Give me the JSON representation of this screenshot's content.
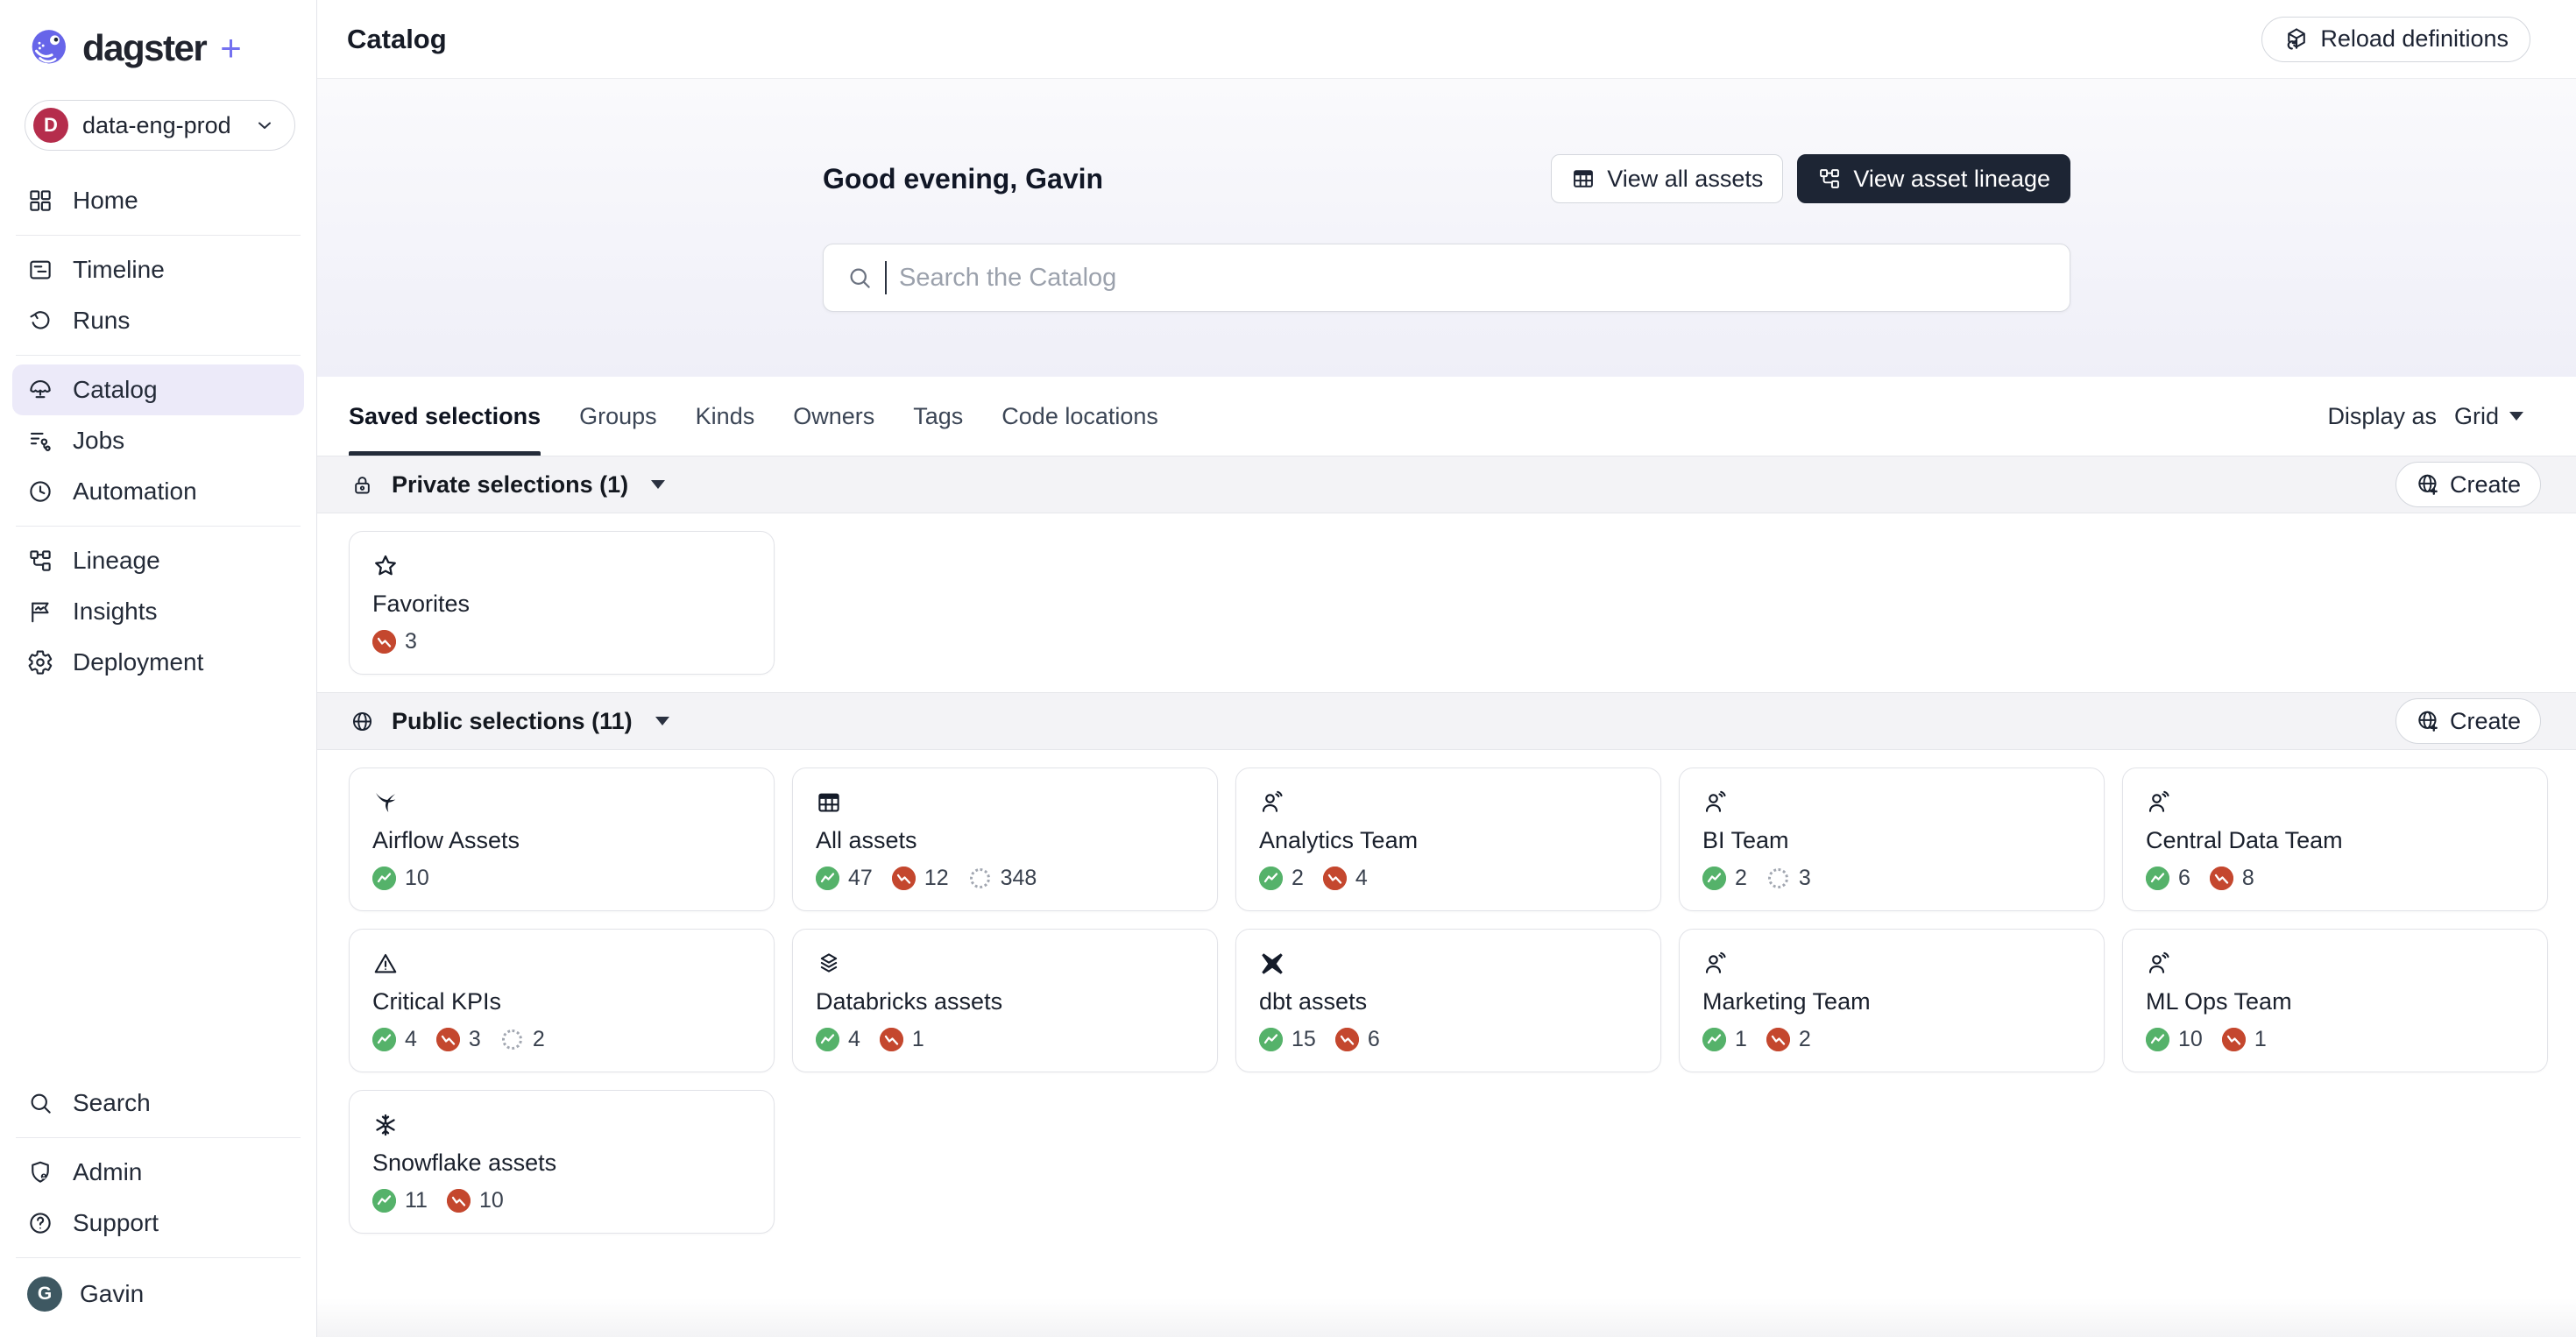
{
  "brand": {
    "name": "dagster",
    "plus": "+"
  },
  "deployment": {
    "avatar_letter": "D",
    "label": "data-eng-prod",
    "caret_icon": "chevron-down-icon"
  },
  "sidebar": {
    "nav_groups": [
      {
        "items": [
          {
            "label": "Home",
            "icon": "grid-icon",
            "active": false
          }
        ]
      },
      {
        "items": [
          {
            "label": "Timeline",
            "icon": "timeline-icon",
            "active": false
          },
          {
            "label": "Runs",
            "icon": "runs-icon",
            "active": false
          }
        ]
      },
      {
        "items": [
          {
            "label": "Catalog",
            "icon": "catalog-icon",
            "active": true
          },
          {
            "label": "Jobs",
            "icon": "jobs-icon",
            "active": false
          },
          {
            "label": "Automation",
            "icon": "clock-icon",
            "active": false
          }
        ]
      },
      {
        "items": [
          {
            "label": "Lineage",
            "icon": "lineage-icon",
            "active": false
          },
          {
            "label": "Insights",
            "icon": "insights-icon",
            "active": false
          },
          {
            "label": "Deployment",
            "icon": "gear-icon",
            "active": false
          }
        ]
      }
    ],
    "footer_groups": [
      {
        "items": [
          {
            "label": "Search",
            "icon": "search-icon",
            "active": false
          }
        ]
      },
      {
        "items": [
          {
            "label": "Admin",
            "icon": "shield-icon",
            "active": false
          },
          {
            "label": "Support",
            "icon": "help-icon",
            "active": false
          }
        ]
      }
    ],
    "user": {
      "avatar_letter": "G",
      "name": "Gavin"
    }
  },
  "header": {
    "title": "Catalog",
    "reload_label": "Reload definitions",
    "reload_icon": "cube-reload-icon"
  },
  "hero": {
    "greeting": "Good evening, Gavin",
    "view_all_assets_label": "View all assets",
    "view_all_assets_icon": "table-icon",
    "view_asset_lineage_label": "View asset lineage",
    "view_asset_lineage_icon": "lineage-icon",
    "search_placeholder": "Search the Catalog"
  },
  "tabs": {
    "items": [
      "Saved selections",
      "Groups",
      "Kinds",
      "Owners",
      "Tags",
      "Code locations"
    ],
    "active": "Saved selections",
    "display_as_label": "Display as",
    "display_as_value": "Grid"
  },
  "sections": [
    {
      "id": "private",
      "icon": "lock-icon",
      "title": "Private selections (1)",
      "create_label": "Create",
      "create_icon": "globe-plus-icon",
      "cards": [
        {
          "title": "Favorites",
          "icon": "star-icon",
          "stats": [
            {
              "type": "failed",
              "value": "3"
            }
          ]
        }
      ]
    },
    {
      "id": "public",
      "icon": "globe-icon",
      "title": "Public selections (11)",
      "create_label": "Create",
      "create_icon": "globe-plus-icon",
      "cards": [
        {
          "title": "Airflow Assets",
          "icon": "airflow-icon",
          "stats": [
            {
              "type": "success",
              "value": "10"
            }
          ]
        },
        {
          "title": "All assets",
          "icon": "table-icon",
          "stats": [
            {
              "type": "success",
              "value": "47"
            },
            {
              "type": "failed",
              "value": "12"
            },
            {
              "type": "pending",
              "value": "348"
            }
          ]
        },
        {
          "title": "Analytics Team",
          "icon": "users-icon",
          "stats": [
            {
              "type": "success",
              "value": "2"
            },
            {
              "type": "failed",
              "value": "4"
            }
          ]
        },
        {
          "title": "BI Team",
          "icon": "users-icon",
          "stats": [
            {
              "type": "success",
              "value": "2"
            },
            {
              "type": "pending",
              "value": "3"
            }
          ]
        },
        {
          "title": "Central Data Team",
          "icon": "users-icon",
          "stats": [
            {
              "type": "success",
              "value": "6"
            },
            {
              "type": "failed",
              "value": "8"
            }
          ]
        },
        {
          "title": "Critical KPIs",
          "icon": "warning-icon",
          "stats": [
            {
              "type": "success",
              "value": "4"
            },
            {
              "type": "failed",
              "value": "3"
            },
            {
              "type": "pending",
              "value": "2"
            }
          ]
        },
        {
          "title": "Databricks assets",
          "icon": "layers-icon",
          "stats": [
            {
              "type": "success",
              "value": "4"
            },
            {
              "type": "failed",
              "value": "1"
            }
          ]
        },
        {
          "title": "dbt assets",
          "icon": "dbt-icon",
          "stats": [
            {
              "type": "success",
              "value": "15"
            },
            {
              "type": "failed",
              "value": "6"
            }
          ]
        },
        {
          "title": "Marketing Team",
          "icon": "users-icon",
          "stats": [
            {
              "type": "success",
              "value": "1"
            },
            {
              "type": "failed",
              "value": "2"
            }
          ]
        },
        {
          "title": "ML Ops Team",
          "icon": "users-icon",
          "stats": [
            {
              "type": "success",
              "value": "10"
            },
            {
              "type": "failed",
              "value": "1"
            }
          ]
        },
        {
          "title": "Snowflake assets",
          "icon": "snowflake-icon",
          "stats": [
            {
              "type": "success",
              "value": "11"
            },
            {
              "type": "failed",
              "value": "10"
            }
          ]
        }
      ]
    }
  ],
  "colors": {
    "accent": "#6765E9",
    "nav_active_bg": "#ECEAF9",
    "success": "#55B26A",
    "failed": "#C4472E",
    "pending": "#A2A7B1",
    "dark_button": "#1D2534",
    "deployment_avatar": "#B52D4C",
    "user_avatar": "#3E5862"
  }
}
